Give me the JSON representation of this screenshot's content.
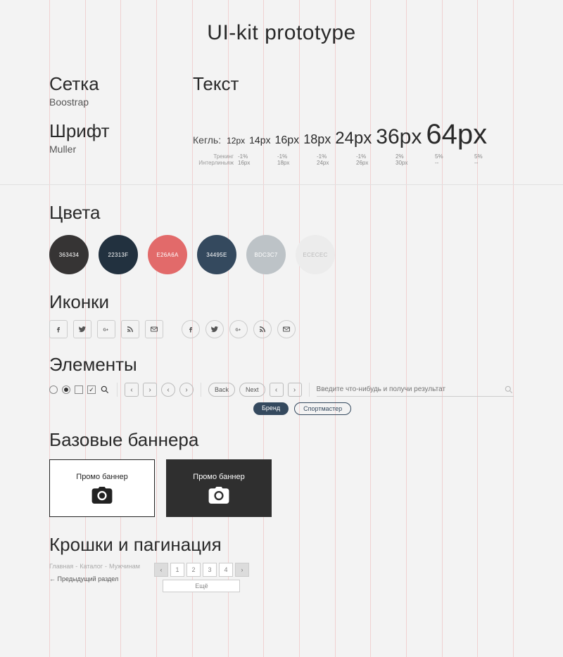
{
  "title": "UI-kit prototype",
  "grid": {
    "heading": "Сетка",
    "value": "Boostrap"
  },
  "font": {
    "heading": "Шрифт",
    "value": "Muller"
  },
  "text": {
    "heading": "Текст",
    "kegl_label": "Кегль:",
    "sizes": [
      "12px",
      "14px",
      "16px",
      "18px",
      "24px",
      "36px",
      "64px"
    ],
    "tracking_label": "Трекинг",
    "tracking": [
      "-1%",
      "-1%",
      "-1%",
      "-1%",
      "2%",
      "5%",
      "5%"
    ],
    "leading_label": "Интерлиньяж",
    "leading": [
      "16px",
      "18px",
      "24px",
      "26px",
      "30px",
      "--",
      "--"
    ]
  },
  "colors": {
    "heading": "Цвета",
    "swatches": [
      {
        "hex": "#363434",
        "label": "363434",
        "text": "#fff"
      },
      {
        "hex": "#22313F",
        "label": "22313F",
        "text": "#fff"
      },
      {
        "hex": "#E26A6A",
        "label": "E26A6A",
        "text": "#fff"
      },
      {
        "hex": "#34495E",
        "label": "34495E",
        "text": "#fff"
      },
      {
        "hex": "#BDC3C7",
        "label": "BDC3C7",
        "text": "#fff"
      },
      {
        "hex": "#ECECEC",
        "label": "ECECEC",
        "text": "#bbb"
      }
    ]
  },
  "icons": {
    "heading": "Иконки"
  },
  "elements": {
    "heading": "Элементы",
    "back": "Back",
    "next": "Next",
    "search_placeholder": "Введите что-нибудь и получи результат",
    "tag_brand": "Бренд",
    "tag_store": "Спортмастер"
  },
  "banners": {
    "heading": "Базовые баннера",
    "light_label": "Промо баннер",
    "dark_label": "Промо баннер"
  },
  "crumbs": {
    "heading": "Крошки и пагинация",
    "path": [
      "Главная",
      "Каталог",
      "Мужчинам"
    ],
    "back": "← Предыдущий раздел",
    "pages": [
      "1",
      "2",
      "3",
      "4"
    ],
    "more": "Ещё"
  }
}
